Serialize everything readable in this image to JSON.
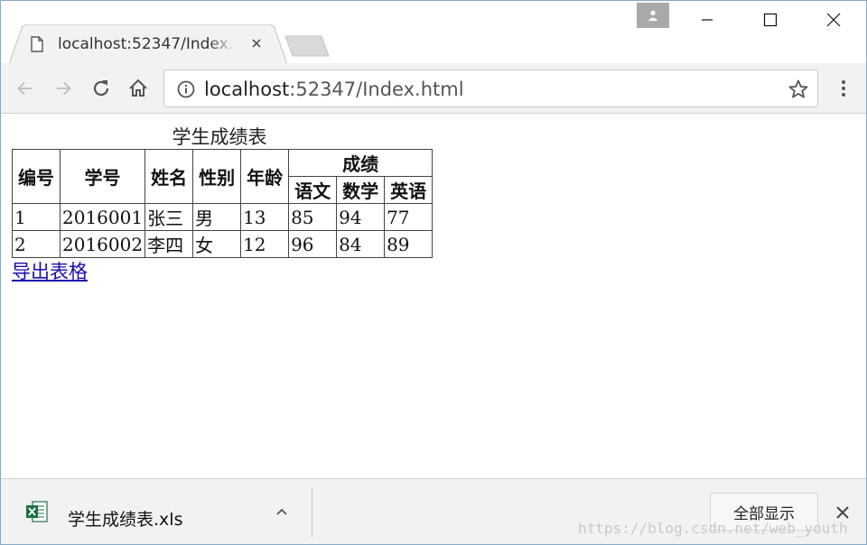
{
  "tab": {
    "title": "localhost:52347/Index.html"
  },
  "address_bar": {
    "url_host": "localhost",
    "url_rest": ":52347/Index.html"
  },
  "page": {
    "caption": "学生成绩表",
    "table": {
      "headers": [
        "编号",
        "学号",
        "姓名",
        "性别",
        "年龄"
      ],
      "group_header": "成绩",
      "sub_headers": [
        "语文",
        "数学",
        "英语"
      ],
      "rows": [
        [
          "1",
          "2016001",
          "张三",
          "男",
          "13",
          "85",
          "94",
          "77"
        ],
        [
          "2",
          "2016002",
          "李四",
          "女",
          "12",
          "96",
          "84",
          "89"
        ]
      ]
    },
    "export_link": "导出表格"
  },
  "download_bar": {
    "file_name": "学生成绩表.xls",
    "show_all_label": "全部显示",
    "watermark": "https://blog.csdn.net/web_youth"
  },
  "colors": {
    "link": "#1a0dab",
    "excel_green": "#1e7145",
    "chrome_bg": "#f2f2f2"
  },
  "icons": [
    "page-icon",
    "close-icon",
    "back-icon",
    "forward-icon",
    "reload-icon",
    "home-icon",
    "info-icon",
    "star-icon",
    "menu-icon",
    "excel-file-icon",
    "chevron-up-icon",
    "profile-icon",
    "minimize-icon",
    "maximize-icon"
  ]
}
